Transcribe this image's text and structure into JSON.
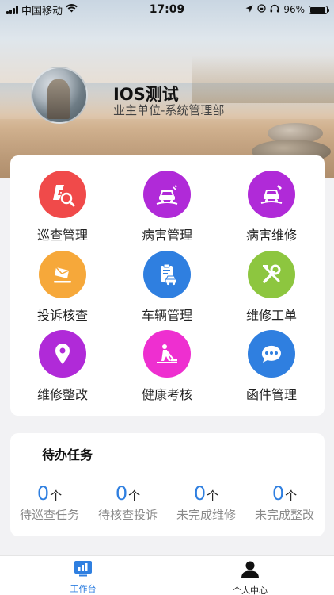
{
  "status_bar": {
    "carrier": "中国移动",
    "time": "17:09",
    "battery_percent": "96%",
    "battery_level": 0.96
  },
  "profile": {
    "name": "IOS测试",
    "organization": "业主单位-系统管理部"
  },
  "menu": [
    {
      "label": "巡查管理",
      "icon": "patrol-search-icon",
      "color": "#f04a4a"
    },
    {
      "label": "病害管理",
      "icon": "damaged-car-icon",
      "color": "#b02ad8"
    },
    {
      "label": "病害维修",
      "icon": "car-repair-icon",
      "color": "#b02ad8"
    },
    {
      "label": "投诉核查",
      "icon": "complaint-envelope-icon",
      "color": "#f6a83a"
    },
    {
      "label": "车辆管理",
      "icon": "vehicle-clipboard-icon",
      "color": "#2f7fe0"
    },
    {
      "label": "维修工单",
      "icon": "tools-icon",
      "color": "#8dc63f"
    },
    {
      "label": "维修整改",
      "icon": "location-pin-icon",
      "color": "#b02ad8"
    },
    {
      "label": "健康考核",
      "icon": "road-work-icon",
      "color": "#ee2fd0"
    },
    {
      "label": "函件管理",
      "icon": "chat-bubble-icon",
      "color": "#2f7fe0"
    }
  ],
  "todo": {
    "title": "待办任务",
    "unit": "个",
    "items": [
      {
        "count": "0",
        "label": "待巡查任务"
      },
      {
        "count": "0",
        "label": "待核查投诉"
      },
      {
        "count": "0",
        "label": "未完成维修"
      },
      {
        "count": "0",
        "label": "未完成整改"
      }
    ]
  },
  "tabbar": {
    "tabs": [
      {
        "label": "工作台",
        "icon": "workbench-chart-icon",
        "active": true,
        "color": "#2f7fe0"
      },
      {
        "label": "个人中心",
        "icon": "person-icon",
        "active": false,
        "color": "#222222"
      }
    ]
  }
}
